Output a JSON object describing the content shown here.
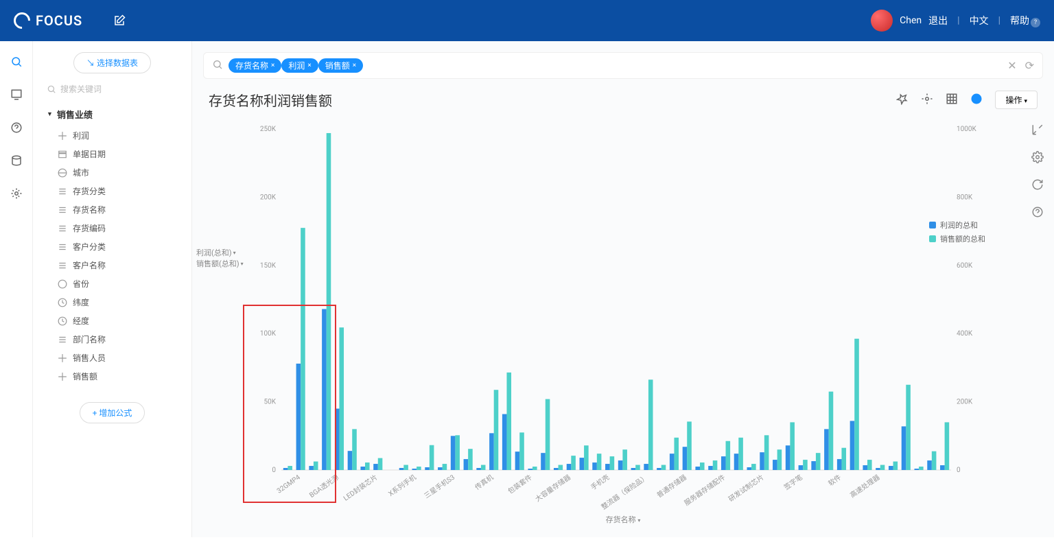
{
  "brand": "FOCUS",
  "user_name": "Chen",
  "top_links": {
    "logout": "退出",
    "lang": "中文",
    "help": "帮助"
  },
  "sidebar": {
    "select_table": "↘ 选择数据表",
    "search_placeholder": "搜索关键词",
    "group": "销售业绩",
    "fields": [
      "利润",
      "单据日期",
      "城市",
      "存货分类",
      "存货名称",
      "存货编码",
      "客户分类",
      "客户名称",
      "省份",
      "纬度",
      "经度",
      "部门名称",
      "销售人员",
      "销售额"
    ],
    "add_formula": "+ 增加公式"
  },
  "query_pills": [
    "存货名称",
    "利润",
    "销售额"
  ],
  "title": "存货名称利润销售额",
  "ops": "操作",
  "axis_buttons": [
    "利润(总和)",
    "销售额(总和)"
  ],
  "xlabel": "存货名称",
  "legend": [
    {
      "label": "利润的总和",
      "color": "#2f8fe6"
    },
    {
      "label": "销售额的总和",
      "color": "#4dd0c9"
    }
  ],
  "chart_data": {
    "type": "bar",
    "xlabel": "存货名称",
    "y_left": {
      "label": "利润(总和)",
      "range": [
        0,
        250000
      ],
      "ticks": [
        0,
        "50K",
        "100K",
        "150K",
        "200K",
        "250K"
      ]
    },
    "y_right": {
      "label": "销售额(总和)",
      "range": [
        0,
        1000000
      ],
      "ticks": [
        0,
        "200K",
        "400K",
        "600K",
        "800K",
        "1000K"
      ]
    },
    "visible_x_labels": [
      "32GMP4",
      "BGA透光源",
      "LED封装芯片",
      "X系列手机",
      "三星手机S3",
      "传真机",
      "包装套件",
      "大容量存储器",
      "手机壳",
      "整流器（保险品）",
      "普通存储器",
      "服务器存储配件",
      "研发试制芯片",
      "签字笔",
      "软件",
      "高速处理器"
    ],
    "series": [
      {
        "name": "利润的总和",
        "axis": "left",
        "color": "#2f8fe6",
        "values": [
          1500,
          78000,
          3000,
          118000,
          45000,
          14000,
          2500,
          4500,
          0,
          1500,
          1000,
          2000,
          2000,
          25000,
          8000,
          1500,
          27000,
          41000,
          13500,
          1000,
          12500,
          1500,
          4500,
          9000,
          5500,
          4500,
          7000,
          1500,
          4500,
          1500,
          12000,
          17000,
          2500,
          3000,
          10000,
          12000,
          2000,
          13000,
          7500,
          18000,
          3500,
          6500,
          30000,
          8000,
          36000,
          3500,
          1500,
          3000,
          32000,
          1000,
          7000,
          3500
        ]
      },
      {
        "name": "销售额的总和",
        "axis": "right",
        "color": "#4dd0c9",
        "values": [
          12000,
          710000,
          25000,
          988000,
          418000,
          120000,
          22000,
          35000,
          0,
          15000,
          10000,
          73000,
          18000,
          102000,
          62000,
          15000,
          235000,
          286000,
          110000,
          10000,
          208000,
          15000,
          42000,
          72000,
          48000,
          40000,
          60000,
          15000,
          265000,
          15000,
          95000,
          142000,
          22000,
          28000,
          85000,
          95000,
          18000,
          102000,
          60000,
          140000,
          30000,
          50000,
          230000,
          65000,
          385000,
          30000,
          15000,
          25000,
          250000,
          10000,
          55000,
          140000
        ]
      }
    ],
    "highlighted_range": {
      "start_index": 0,
      "end_index": 5,
      "note": "red box around first ~6 categories"
    }
  }
}
